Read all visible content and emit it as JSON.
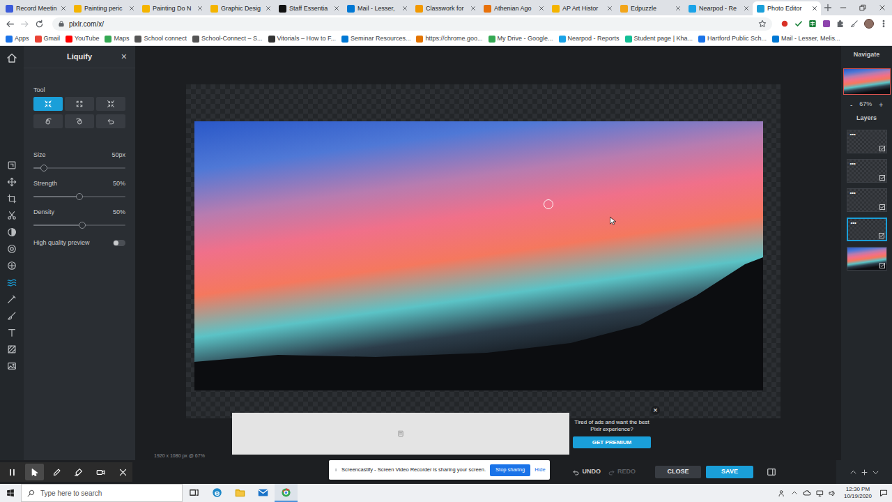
{
  "browser": {
    "tabs": [
      {
        "label": "Record Meetin",
        "selected": false,
        "color": "#3b5bdb"
      },
      {
        "label": "Painting peric",
        "selected": false,
        "color": "#f4b400"
      },
      {
        "label": "Painting Do N",
        "selected": false,
        "color": "#f4b400"
      },
      {
        "label": "Graphic Desig",
        "selected": false,
        "color": "#f4b400"
      },
      {
        "label": "Staff Essentia",
        "selected": false,
        "color": "#111111"
      },
      {
        "label": "Mail - Lesser,",
        "selected": false,
        "color": "#0078d4"
      },
      {
        "label": "Classwork for",
        "selected": false,
        "color": "#f29900"
      },
      {
        "label": "Athenian Ago",
        "selected": false,
        "color": "#e8710a"
      },
      {
        "label": "AP Art Histor",
        "selected": false,
        "color": "#f4b400"
      },
      {
        "label": "Edpuzzle",
        "selected": false,
        "color": "#f2a51a"
      },
      {
        "label": "Nearpod - Re",
        "selected": false,
        "color": "#1aa3e8"
      },
      {
        "label": "Photo Editor",
        "selected": true,
        "color": "#1a9fd9"
      }
    ],
    "forward_disabled": true,
    "address": "pixlr.com/x/",
    "bookmarks": [
      {
        "label": "Apps",
        "color": "#1a73e8"
      },
      {
        "label": "Gmail",
        "color": "#ea4335"
      },
      {
        "label": "YouTube",
        "color": "#ff0000"
      },
      {
        "label": "Maps",
        "color": "#34a853"
      },
      {
        "label": "School connect",
        "color": "#555555"
      },
      {
        "label": "School-Connect – S...",
        "color": "#555555"
      },
      {
        "label": "Vitorials – How to F...",
        "color": "#333333"
      },
      {
        "label": "Seminar Resources...",
        "color": "#0078d4"
      },
      {
        "label": "https://chrome.goo...",
        "color": "#e37400"
      },
      {
        "label": "My Drive - Google...",
        "color": "#34a853"
      },
      {
        "label": "Nearpod - Reports",
        "color": "#1aa3e8"
      },
      {
        "label": "Student page | Kha...",
        "color": "#14bf96"
      },
      {
        "label": "Hartford Public Sch...",
        "color": "#1a73e8"
      },
      {
        "label": "Mail - Lesser, Melis...",
        "color": "#0078d4"
      }
    ]
  },
  "editor": {
    "toolbar": [
      {
        "kind": "arrange",
        "selected": false
      },
      {
        "kind": "move",
        "selected": false
      },
      {
        "kind": "crop",
        "selected": false
      },
      {
        "kind": "cutout",
        "selected": false
      },
      {
        "kind": "adjust",
        "selected": false
      },
      {
        "kind": "filter",
        "selected": false
      },
      {
        "kind": "effect",
        "selected": false
      },
      {
        "kind": "liquify",
        "selected": true
      },
      {
        "kind": "picker",
        "selected": false
      },
      {
        "kind": "brush",
        "selected": false
      },
      {
        "kind": "text",
        "selected": false
      },
      {
        "kind": "fill",
        "selected": false
      },
      {
        "kind": "image",
        "selected": false
      }
    ],
    "liquify": {
      "title": "Liquify",
      "close": "×",
      "tool_label": "Tool",
      "tools": [
        {
          "kind": "push",
          "selected": true
        },
        {
          "kind": "expand",
          "selected": false
        },
        {
          "kind": "pinch",
          "selected": false
        },
        {
          "kind": "swirl-cw",
          "selected": false
        },
        {
          "kind": "swirl-ccw",
          "selected": false
        },
        {
          "kind": "restore",
          "selected": false
        }
      ],
      "sliders": [
        {
          "label": "Size",
          "value": "50px",
          "level": 0.11
        },
        {
          "label": "Strength",
          "value": "50%",
          "level": 0.5
        },
        {
          "label": "Density",
          "value": "50%",
          "level": 0.53
        }
      ],
      "toggle": {
        "label": "High quality preview",
        "on": false
      }
    },
    "navigate": {
      "title": "Navigate",
      "zoom_out": "-",
      "zoom": "67%",
      "zoom_in": "+"
    },
    "layers": {
      "title": "Layers",
      "items": [
        {
          "label": "•••",
          "kind": "blank",
          "selected": false,
          "visible": true
        },
        {
          "label": "•••",
          "kind": "blank",
          "selected": false,
          "visible": true
        },
        {
          "label": "•••",
          "kind": "blank",
          "selected": false,
          "visible": true
        },
        {
          "label": "•••",
          "kind": "blank",
          "selected": true,
          "visible": true
        },
        {
          "kind": "photo",
          "selected": false,
          "visible": true
        }
      ]
    },
    "canvas": {
      "info": "1920 x 1080 px @ 67%"
    },
    "ad": {
      "close": "×",
      "message": "Tired of ads and want the best Pixlr experience?",
      "button": "GET PREMIUM"
    },
    "actions": [
      {
        "label": "UNDO",
        "kind": "undo",
        "disabled": false
      },
      {
        "label": "REDO",
        "kind": "redo",
        "disabled": true
      },
      {
        "label": "CLOSE",
        "kind": "close",
        "disabled": false
      },
      {
        "label": "SAVE",
        "kind": "save",
        "disabled": false
      }
    ]
  },
  "screencastify": {
    "tools": [
      {
        "kind": "pause",
        "selected": false
      },
      {
        "kind": "pointer",
        "selected": true
      },
      {
        "kind": "pen",
        "selected": false
      },
      {
        "kind": "highlighter",
        "selected": false
      },
      {
        "kind": "camera",
        "selected": false
      },
      {
        "kind": "exit",
        "selected": false
      }
    ],
    "notice": "Screencastify - Screen Video Recorder is sharing your screen.",
    "stop": "Stop sharing",
    "hide": "Hide"
  },
  "taskbar": {
    "search": "Type here to search",
    "apps": [
      {
        "kind": "taskview",
        "active": false
      },
      {
        "kind": "edge",
        "active": false
      },
      {
        "kind": "explorer",
        "active": false
      },
      {
        "kind": "mail",
        "active": false
      },
      {
        "kind": "chrome",
        "active": true
      }
    ],
    "time": "12:30 PM",
    "date": "10/19/2020"
  }
}
